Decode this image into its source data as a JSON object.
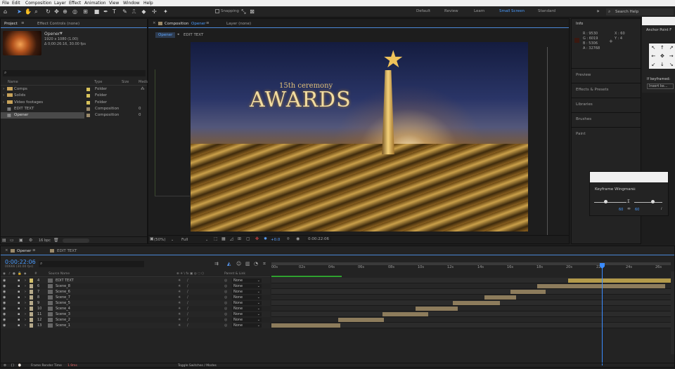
{
  "menu": [
    "File",
    "Edit",
    "Composition",
    "Layer",
    "Effect",
    "Animation",
    "View",
    "Window",
    "Help"
  ],
  "toolbar": {
    "snapping_label": "Snapping"
  },
  "workspaces": [
    "Default",
    "Review",
    "Learn",
    "Small Screen",
    "Standard"
  ],
  "search_help_placeholder": "Search Help",
  "project": {
    "tab_project": "Project",
    "tab_effect_controls": "Effect Controls (none)",
    "selected_name": "Opener",
    "selected_size": "1920 x 1080 (1.00)",
    "selected_duration": "Δ 0;00:26:16, 30.00 fps",
    "columns": [
      "Name",
      "Type",
      "Size",
      "Media"
    ],
    "items": [
      {
        "name": "Comps",
        "type": "Folder"
      },
      {
        "name": "Solids",
        "type": "Folder"
      },
      {
        "name": "Video footages",
        "type": "Folder"
      },
      {
        "name": "EDIT TEXT",
        "type": "Composition"
      },
      {
        "name": "Opener",
        "type": "Composition"
      }
    ],
    "bpc": "16 bpc"
  },
  "comp": {
    "tab_label": "Composition",
    "tab_name": "Opener",
    "layer_tab": "Layer (none)",
    "breadcrumb_1": "Opener",
    "breadcrumb_2": "EDIT TEXT",
    "zoom": "(50%)",
    "resolution": "Full",
    "exposure": "+0.0",
    "timecode": "0:00:22:06",
    "headline_small": "15th ceremony",
    "headline_big": "AWARDS"
  },
  "info": {
    "title": "Info",
    "r": "R : 9530",
    "g": "G : 6019",
    "b": "B : 5306",
    "a": "A : 32768",
    "x": "X : 60",
    "y": "Y : 4"
  },
  "right_panels": [
    "Preview",
    "Effects & Presets",
    "Libraries",
    "Brushes",
    "Paint"
  ],
  "anchor": {
    "title": "Anchor Point F",
    "if_keyframed": "If keyframed:",
    "insert": "Insert ke..."
  },
  "wingman": {
    "title": "Keyframe Wingman",
    "left_val": "60",
    "right_val": "60"
  },
  "timeline": {
    "tab_opener": "Opener",
    "tab_edit": "EDIT TEXT",
    "timecode": "0:00:22:06",
    "frames": "00666 (30.00 fps)",
    "col_source": "Source Name",
    "col_parent": "Parent & Link",
    "ruler": [
      "00s",
      "02s",
      "04s",
      "06s",
      "08s",
      "10s",
      "12s",
      "14s",
      "16s",
      "18s",
      "20s",
      "22s",
      "24s",
      "26s"
    ],
    "layers": [
      {
        "num": "4",
        "name": "EDIT TEXT",
        "parent": "None"
      },
      {
        "num": "6",
        "name": "Scene_8",
        "parent": "None"
      },
      {
        "num": "7",
        "name": "Scene_6",
        "parent": "None"
      },
      {
        "num": "8",
        "name": "Scene_7",
        "parent": "None"
      },
      {
        "num": "9",
        "name": "Scene_5",
        "parent": "None"
      },
      {
        "num": "10",
        "name": "Scene_4",
        "parent": "None"
      },
      {
        "num": "11",
        "name": "Scene_3",
        "parent": "None"
      },
      {
        "num": "12",
        "name": "Scene_2",
        "parent": "None"
      },
      {
        "num": "13",
        "name": "Scene_1",
        "parent": "None"
      }
    ],
    "footer_left": "Frame Render Time",
    "footer_val": "1.9ms",
    "footer_mid": "Toggle Switches / Modes"
  }
}
